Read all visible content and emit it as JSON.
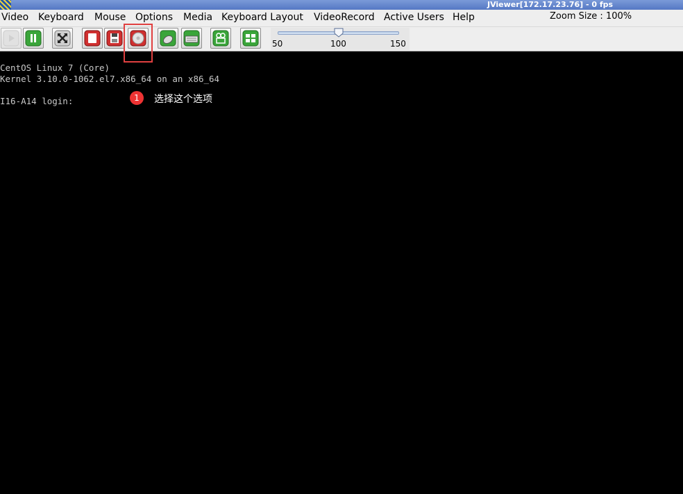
{
  "window": {
    "title": "JViewer[172.17.23.76] - 0 fps"
  },
  "menu": {
    "items": [
      "Video",
      "Keyboard",
      "Mouse",
      "Options",
      "Media",
      "Keyboard Layout",
      "VideoRecord",
      "Active Users",
      "Help"
    ],
    "zoom_size": "Zoom Size : 100%"
  },
  "toolbar": {
    "buttons": [
      {
        "icon": "play-icon",
        "enabled": false
      },
      {
        "icon": "pause-icon"
      },
      {
        "icon": "fullscreen-icon"
      },
      {
        "icon": "record-icon"
      },
      {
        "icon": "floppy-disk-icon"
      },
      {
        "icon": "cd-dvd-icon",
        "highlighted": true
      },
      {
        "icon": "mouse-icon"
      },
      {
        "icon": "keyboard-icon"
      },
      {
        "icon": "video-record-icon"
      },
      {
        "icon": "active-users-icon"
      }
    ]
  },
  "zoom_slider": {
    "min_label": "50",
    "mid_label": "100",
    "max_label": "150",
    "value": 100
  },
  "console": {
    "lines": [
      "CentOS Linux 7 (Core)",
      "Kernel 3.10.0-1062.el7.x86_64 on an x86_64",
      "I16-A14 login:"
    ]
  },
  "annotation": {
    "badge": "1",
    "text": "选择这个选项"
  },
  "colors": {
    "highlight": "#e04040",
    "badge": "#ee3333",
    "button_green": "#3aa53a",
    "button_red": "#d03030"
  }
}
